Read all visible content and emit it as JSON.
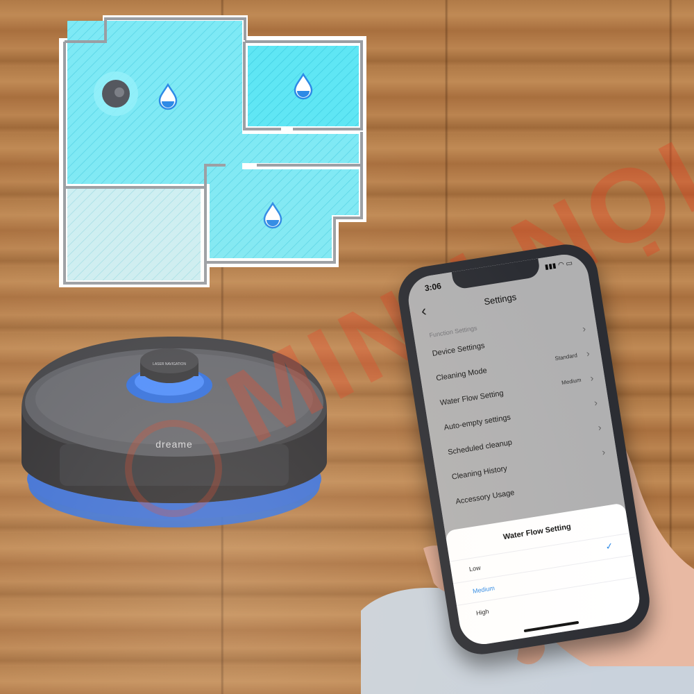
{
  "phone": {
    "status_time": "3:06",
    "status_icons": "▮▮▮ ◠ ▭",
    "back_icon": "chevron-left-icon",
    "title": "Settings",
    "section_header": "Function Settings",
    "rows": [
      {
        "label": "Device Settings",
        "value": ""
      },
      {
        "label": "Cleaning Mode",
        "value": "Standard"
      },
      {
        "label": "Water Flow Setting",
        "value": "Medium"
      },
      {
        "label": "Auto-empty settings",
        "value": ""
      },
      {
        "label": "Scheduled cleanup",
        "value": ""
      },
      {
        "label": "Cleaning History",
        "value": ""
      },
      {
        "label": "Accessory Usage",
        "value": ""
      }
    ],
    "sheet": {
      "title": "Water Flow Setting",
      "options": [
        {
          "label": "Low",
          "selected": false
        },
        {
          "label": "Medium",
          "selected": true
        },
        {
          "label": "High",
          "selected": false
        }
      ]
    }
  },
  "robot": {
    "brand": "dreame",
    "laser_label": "LASER NAVIGATION"
  },
  "watermark": {
    "text": "MINH NỌI"
  },
  "colors": {
    "map_fill": "#6fe8f4",
    "map_fill_light": "#c6f2f6",
    "accent_blue": "#2d8ae6",
    "robot_glow": "#3a7bff"
  }
}
